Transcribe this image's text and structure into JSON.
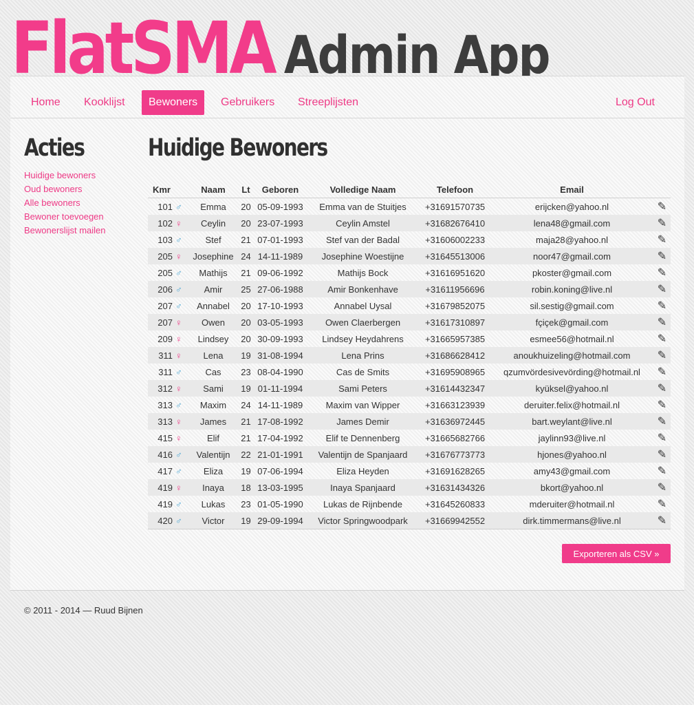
{
  "header": {
    "logo_pink": "FlatSMA",
    "logo_dark": "Admin App"
  },
  "nav": {
    "home": "Home",
    "kooklijst": "Kooklijst",
    "bewoners": "Bewoners",
    "gebruikers": "Gebruikers",
    "streeplijsten": "Streeplijsten",
    "logout": "Log Out"
  },
  "sidebar": {
    "title": "Acties",
    "links": [
      "Huidige bewoners",
      "Oud bewoners",
      "Alle bewoners",
      "Bewoner toevoegen",
      "Bewonerslijst mailen"
    ]
  },
  "main": {
    "title": "Huidige Bewoners",
    "columns": [
      "Kmr",
      "Naam",
      "Lt",
      "Geboren",
      "Volledige Naam",
      "Telefoon",
      "Email"
    ],
    "rows": [
      {
        "kmr": "101",
        "gender": "male",
        "naam": "Emma",
        "lt": "20",
        "geboren": "05-09-1993",
        "volledige_naam": "Emma van de Stuitjes",
        "telefoon": "+31691570735",
        "email": "erijcken@yahoo.nl"
      },
      {
        "kmr": "102",
        "gender": "female",
        "naam": "Ceylin",
        "lt": "20",
        "geboren": "23-07-1993",
        "volledige_naam": "Ceylin Amstel",
        "telefoon": "+31682676410",
        "email": "lena48@gmail.com"
      },
      {
        "kmr": "103",
        "gender": "male",
        "naam": "Stef",
        "lt": "21",
        "geboren": "07-01-1993",
        "volledige_naam": "Stef van der Badal",
        "telefoon": "+31606002233",
        "email": "maja28@yahoo.nl"
      },
      {
        "kmr": "205",
        "gender": "female",
        "naam": "Josephine",
        "lt": "24",
        "geboren": "14-11-1989",
        "volledige_naam": "Josephine Woestijne",
        "telefoon": "+31645513006",
        "email": "noor47@gmail.com"
      },
      {
        "kmr": "205",
        "gender": "male",
        "naam": "Mathijs",
        "lt": "21",
        "geboren": "09-06-1992",
        "volledige_naam": "Mathijs Bock",
        "telefoon": "+31616951620",
        "email": "pkoster@gmail.com"
      },
      {
        "kmr": "206",
        "gender": "male",
        "naam": "Amir",
        "lt": "25",
        "geboren": "27-06-1988",
        "volledige_naam": "Amir Bonkenhave",
        "telefoon": "+31611956696",
        "email": "robin.koning@live.nl"
      },
      {
        "kmr": "207",
        "gender": "male",
        "naam": "Annabel",
        "lt": "20",
        "geboren": "17-10-1993",
        "volledige_naam": "Annabel Uysal",
        "telefoon": "+31679852075",
        "email": "sil.sestig@gmail.com"
      },
      {
        "kmr": "207",
        "gender": "female",
        "naam": "Owen",
        "lt": "20",
        "geboren": "03-05-1993",
        "volledige_naam": "Owen Claerbergen",
        "telefoon": "+31617310897",
        "email": "fçiçek@gmail.com"
      },
      {
        "kmr": "209",
        "gender": "female",
        "naam": "Lindsey",
        "lt": "20",
        "geboren": "30-09-1993",
        "volledige_naam": "Lindsey Heydahrens",
        "telefoon": "+31665957385",
        "email": "esmee56@hotmail.nl"
      },
      {
        "kmr": "311",
        "gender": "female",
        "naam": "Lena",
        "lt": "19",
        "geboren": "31-08-1994",
        "volledige_naam": "Lena Prins",
        "telefoon": "+31686628412",
        "email": "anoukhuizeling@hotmail.com"
      },
      {
        "kmr": "311",
        "gender": "male",
        "naam": "Cas",
        "lt": "23",
        "geboren": "08-04-1990",
        "volledige_naam": "Cas de Smits",
        "telefoon": "+31695908965",
        "email": "qzumvördesivevörding@hotmail.nl"
      },
      {
        "kmr": "312",
        "gender": "female",
        "naam": "Sami",
        "lt": "19",
        "geboren": "01-11-1994",
        "volledige_naam": "Sami Peters",
        "telefoon": "+31614432347",
        "email": "kyüksel@yahoo.nl"
      },
      {
        "kmr": "313",
        "gender": "male",
        "naam": "Maxim",
        "lt": "24",
        "geboren": "14-11-1989",
        "volledige_naam": "Maxim van Wipper",
        "telefoon": "+31663123939",
        "email": "deruiter.felix@hotmail.nl"
      },
      {
        "kmr": "313",
        "gender": "female",
        "naam": "James",
        "lt": "21",
        "geboren": "17-08-1992",
        "volledige_naam": "James Demir",
        "telefoon": "+31636972445",
        "email": "bart.weylant@live.nl"
      },
      {
        "kmr": "415",
        "gender": "female",
        "naam": "Elif",
        "lt": "21",
        "geboren": "17-04-1992",
        "volledige_naam": "Elif te Dennenberg",
        "telefoon": "+31665682766",
        "email": "jaylinn93@live.nl"
      },
      {
        "kmr": "416",
        "gender": "male",
        "naam": "Valentijn",
        "lt": "22",
        "geboren": "21-01-1991",
        "volledige_naam": "Valentijn de Spanjaard",
        "telefoon": "+31676773773",
        "email": "hjones@yahoo.nl"
      },
      {
        "kmr": "417",
        "gender": "male",
        "naam": "Eliza",
        "lt": "19",
        "geboren": "07-06-1994",
        "volledige_naam": "Eliza Heyden",
        "telefoon": "+31691628265",
        "email": "amy43@gmail.com"
      },
      {
        "kmr": "419",
        "gender": "female",
        "naam": "Inaya",
        "lt": "18",
        "geboren": "13-03-1995",
        "volledige_naam": "Inaya Spanjaard",
        "telefoon": "+31631434326",
        "email": "bkort@yahoo.nl"
      },
      {
        "kmr": "419",
        "gender": "male",
        "naam": "Lukas",
        "lt": "23",
        "geboren": "01-05-1990",
        "volledige_naam": "Lukas de Rijnbende",
        "telefoon": "+31645260833",
        "email": "mderuiter@hotmail.nl"
      },
      {
        "kmr": "420",
        "gender": "male",
        "naam": "Victor",
        "lt": "19",
        "geboren": "29-09-1994",
        "volledige_naam": "Victor Springwoodpark",
        "telefoon": "+31669942552",
        "email": "dirk.timmermans@live.nl"
      }
    ],
    "icons": {
      "male": "male-icon",
      "female": "female-icon",
      "edit": "pencil-icon"
    },
    "export_label": "Exporteren als CSV »"
  },
  "footer": {
    "text": "© 2011 - 2014 — Ruud Bijnen"
  },
  "colors": {
    "accent": "#f03c8a",
    "male": "#4aa6d4",
    "dark_text": "#3d3d3d"
  }
}
